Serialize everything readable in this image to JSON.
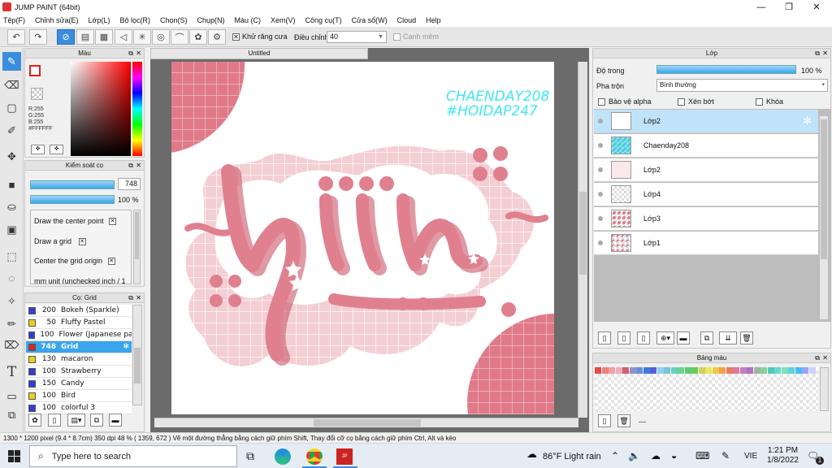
{
  "window": {
    "title": "JUMP PAINT (64bit)",
    "minimize_icon": "minimize-icon",
    "restore_icon": "restore-icon",
    "close_icon": "close-icon"
  },
  "menu": [
    "Tệp(F)",
    "Chỉnh sửa(E)",
    "Lớp(L)",
    "Bộ lọc(R)",
    "Chọn(S)",
    "Chụp(N)",
    "Màu (C)",
    "Xem(V)",
    "Công cụ(T)",
    "Cửa sổ(W)",
    "Cloud",
    "Help"
  ],
  "toolbar": {
    "antialias_label": "Khử răng cưa",
    "adjust_label": "Điều chỉnh",
    "adjust_value": "40",
    "soften_label": "Cạnh mềm"
  },
  "color_panel": {
    "title": "Màu",
    "r": "R:255",
    "g": "G:255",
    "b": "B:255",
    "hex": "#FFFFFF"
  },
  "brush_control": {
    "title": "Kiểm soát cọ",
    "size_value": "748",
    "opacity_value": "100 %",
    "options": [
      "Draw the center point",
      "Draw a grid",
      "Center the grid origin",
      "mm unit (unchecked inch / 1"
    ]
  },
  "brush_list": {
    "title": "Cọ: Grid",
    "items": [
      {
        "size": "200",
        "name": "Bokeh (Sparkle)",
        "color": "#2f3fd6"
      },
      {
        "size": "50",
        "name": "Fluffy Pastel",
        "color": "#e6d21a"
      },
      {
        "size": "100",
        "name": "Flower (Japanese patt",
        "color": "#2f3fd6"
      },
      {
        "size": "748",
        "name": "Grid",
        "color": "#d42a2a",
        "selected": true
      },
      {
        "size": "130",
        "name": "macaron",
        "color": "#e6d21a"
      },
      {
        "size": "100",
        "name": "Strawberry",
        "color": "#2f3fd6"
      },
      {
        "size": "150",
        "name": "Candy",
        "color": "#2f3fd6"
      },
      {
        "size": "100",
        "name": "Bird",
        "color": "#e6d21a"
      },
      {
        "size": "100",
        "name": "colorful 3",
        "color": "#2f3fd6"
      }
    ]
  },
  "document": {
    "tab": "Untitled",
    "art_text1": "CHAENDAY208",
    "art_text2": "#HOIDAP247",
    "art_main": "hiin"
  },
  "layer_panel": {
    "title": "Lớp",
    "opacity_label": "Độ trong",
    "opacity_value": "100 %",
    "blend_label": "Pha trộn",
    "blend_value": "Bình thường",
    "protect_alpha": "Bảo vệ alpha",
    "clipping": "Xén bớt",
    "lock": "Khóa",
    "layers": [
      {
        "name": "Lớp2",
        "selected": true
      },
      {
        "name": "Chaenday208"
      },
      {
        "name": "Lớp2"
      },
      {
        "name": "Lớp4"
      },
      {
        "name": "Lớp3"
      },
      {
        "name": "Lớp1"
      }
    ]
  },
  "palette": {
    "title": "Bảng màu",
    "colors": [
      "#e84a4a",
      "#f08080",
      "#f5a0a0",
      "#e9b0c0",
      "#d06070",
      "#9090d0",
      "#6a8fd8",
      "#3d7bd8",
      "#5b5be0",
      "#8fd0ef",
      "#79c3d7",
      "#63d2c2",
      "#6ad38e",
      "#63c879",
      "#5fd05b",
      "#d0d060",
      "#e8e858",
      "#f1c84a",
      "#f59e50",
      "#e87a60",
      "#e07a96",
      "#c080c0",
      "#b070c0",
      "#9db7a0",
      "#85d0a0",
      "#55c8b8",
      "#69d9d0",
      "#7be0c0",
      "#60d0e0",
      "#3fc0f0",
      "#a0a0ff",
      "#d0d0ff"
    ],
    "more": "---"
  },
  "status": {
    "text": "1300 * 1200 pixel  (9.4 * 8.7cm)  350 dpi  48 %  ( 1359, 672 )  Vẽ một đường thẳng bằng cách giữ phím Shift, Thay đổi cỡ cọ bằng cách giữ phím Ctrl, Alt và kéo"
  },
  "taskbar": {
    "search_placeholder": "Type here to search",
    "weather": "86°F  Light rain",
    "lang": "VIE",
    "time": "1:21 PM",
    "date": "1/8/2022",
    "notif_count": "1"
  }
}
